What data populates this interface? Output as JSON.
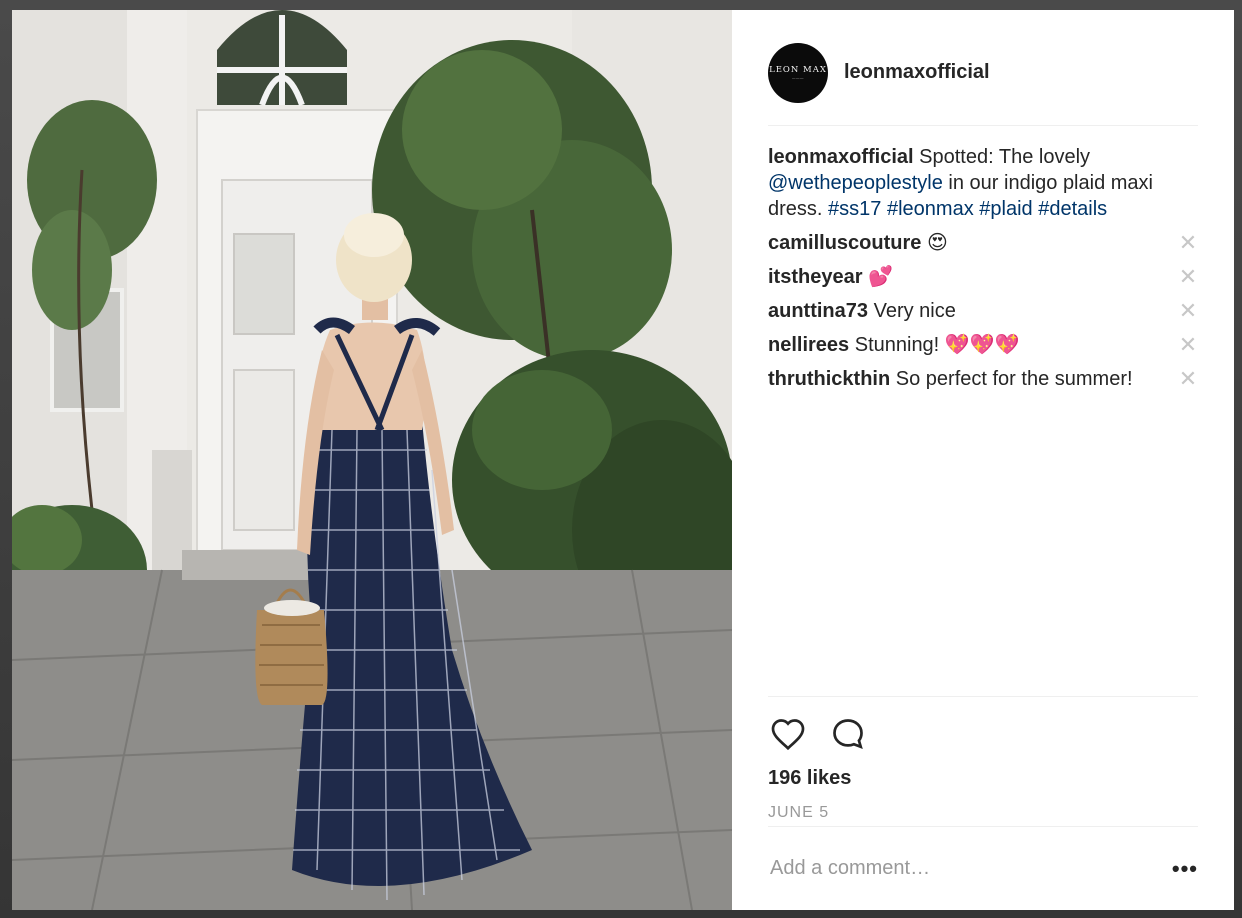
{
  "post": {
    "username": "leonmaxofficial",
    "avatar_brand": "LEON MAX",
    "caption": {
      "user": "leonmaxofficial",
      "text_before": " Spotted: The lovely ",
      "mention": "@wethepeoplestyle",
      "text_after": " in our indigo plaid maxi dress. ",
      "hashtags": [
        "#ss17",
        "#leonmax",
        "#plaid",
        "#details"
      ]
    },
    "comments": [
      {
        "user": "camilluscouture",
        "text": " 😍"
      },
      {
        "user": "itstheyear",
        "text": " 💕"
      },
      {
        "user": "aunttina73",
        "text": " Very nice"
      },
      {
        "user": "nellirees",
        "text": " Stunning! 💖💖💖"
      },
      {
        "user": "thruthickthin",
        "text": " So perfect for the summer!"
      }
    ],
    "delete_glyph": "✕",
    "likes": "196 likes",
    "date": "JUNE 5",
    "add_comment_placeholder": "Add a comment…",
    "more_label": "•••"
  },
  "icons": {
    "like": "heart-icon",
    "comment": "comment-bubble-icon"
  },
  "colors": {
    "link": "#003569",
    "text": "#262626",
    "muted": "#999999",
    "divider": "#efefef"
  }
}
